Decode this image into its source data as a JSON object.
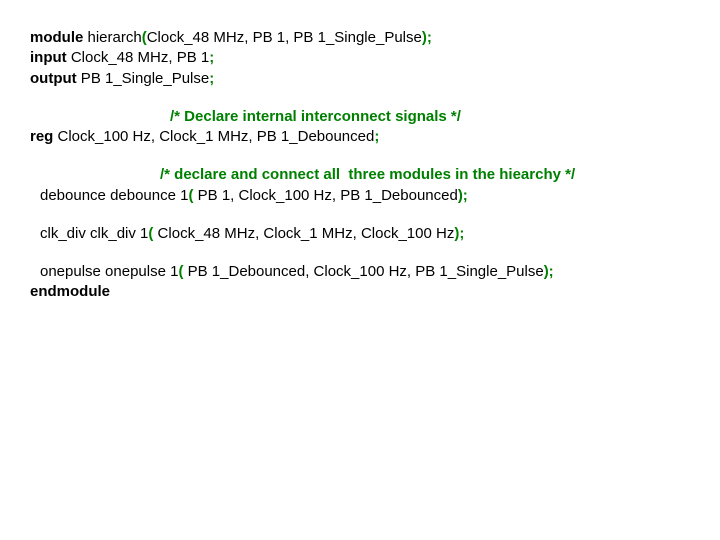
{
  "l1": {
    "kw_module": "module",
    "sp1": " hierarch",
    "paren_open": "(",
    "args": "Clock_48 MHz, PB 1, PB 1_Single_Pulse",
    "paren_close_semi": ");"
  },
  "l2": {
    "kw_input": "input",
    "rest": " Clock_48 MHz, PB 1",
    "semi": ";"
  },
  "l3": {
    "kw_output": "output",
    "rest": " PB 1_Single_Pulse",
    "semi": ";"
  },
  "c1": "/* Declare internal interconnect signals */",
  "l4": {
    "kw_reg": "reg",
    "rest": " Clock_100 Hz, Clock_1 MHz, PB 1_Debounced",
    "semi": ";"
  },
  "c2": "/* declare and connect all  three modules in the hiearchy */",
  "l5": {
    "lead": "debounce debounce 1",
    "paren_open": "(",
    "args": " PB 1, Clock_100 Hz, PB 1_Debounced",
    "paren_close_semi": ");"
  },
  "l6": {
    "lead": "clk_div clk_div 1",
    "paren_open": "(",
    "args": " Clock_48 MHz, Clock_1 MHz, Clock_100 Hz",
    "paren_close_semi": ");"
  },
  "l7": {
    "lead": "onepulse onepulse 1",
    "paren_open": "(",
    "args": " PB 1_Debounced, Clock_100 Hz, PB 1_Single_Pulse",
    "paren_close_semi": ");"
  },
  "l8": {
    "kw_endmodule": "endmodule"
  }
}
